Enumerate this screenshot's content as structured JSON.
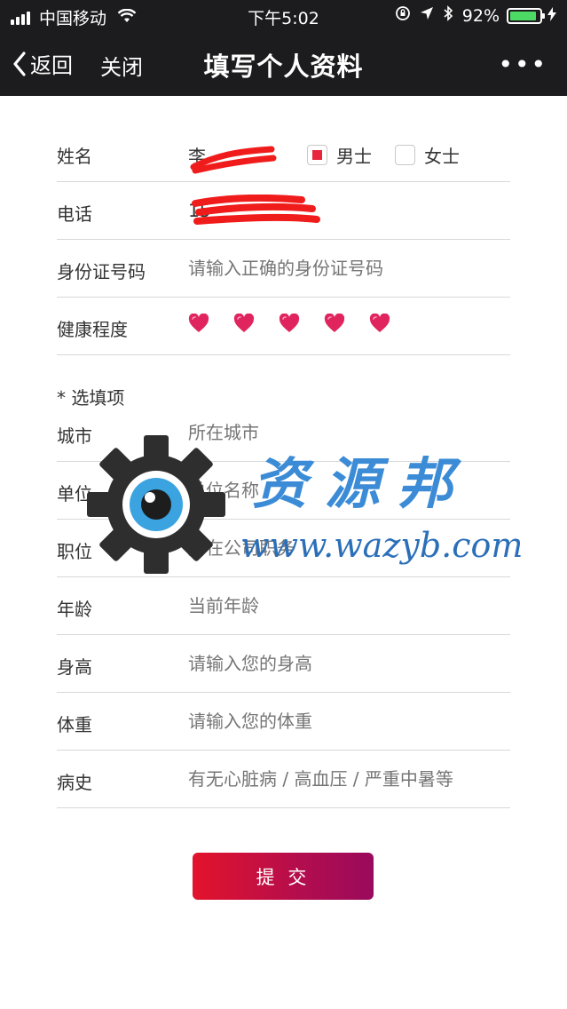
{
  "status_bar": {
    "carrier": "中国移动",
    "time": "下午5:02",
    "battery_percent": "92%",
    "battery_level": 0.92,
    "icons": [
      "signal-icon",
      "wifi-icon",
      "rotation-lock-icon",
      "location-icon",
      "bluetooth-icon",
      "battery-icon",
      "charging-icon"
    ]
  },
  "nav": {
    "back_label": "返回",
    "close_label": "关闭",
    "title": "填写个人资料",
    "more_label": "•••"
  },
  "form": {
    "name": {
      "label": "姓名",
      "value": "李"
    },
    "gender": {
      "options": [
        "男士",
        "女士"
      ],
      "selected": "男士"
    },
    "phone": {
      "label": "电话",
      "value": "15"
    },
    "id_number": {
      "label": "身份证号码",
      "placeholder": "请输入正确的身份证号码"
    },
    "health": {
      "label": "健康程度",
      "rating": 5,
      "max": 5
    }
  },
  "optional_header": "* 选填项",
  "optional_fields": [
    {
      "label": "城市",
      "placeholder": "所在城市"
    },
    {
      "label": "单位",
      "placeholder": "单位名称"
    },
    {
      "label": "职位",
      "placeholder": "所在公司职务"
    },
    {
      "label": "年龄",
      "placeholder": "当前年龄"
    },
    {
      "label": "身高",
      "placeholder": "请输入您的身高"
    },
    {
      "label": "体重",
      "placeholder": "请输入您的体重"
    },
    {
      "label": "病史",
      "placeholder": "有无心脏病 / 高血压 / 严重中暑等"
    }
  ],
  "submit_label": "提 交",
  "watermark": {
    "text": "资源邦",
    "url": "www.wazyb.com"
  },
  "colors": {
    "accent": "#e6273c",
    "heart": "#e0245e",
    "nav_bg": "#1c1c1e",
    "battery": "#4cd964"
  }
}
